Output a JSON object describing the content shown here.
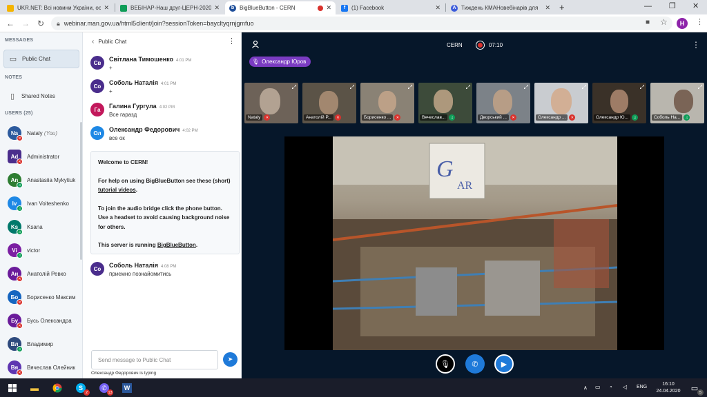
{
  "browser": {
    "tabs": [
      {
        "title": "UKR.NET: Всі новини України, ос",
        "active": false,
        "favicon_color": "#f4b400"
      },
      {
        "title": "ВЕБІНАР-Наш друг-ЦЕРН-2020-",
        "active": false,
        "favicon_color": "#0f9d58"
      },
      {
        "title": "BigBlueButton - CERN",
        "active": true,
        "favicon_color": "#1f4f9a"
      },
      {
        "title": "(1) Facebook",
        "active": false,
        "favicon_color": "#1877f2"
      },
      {
        "title": "Тиждень КМАНовебінарів для",
        "active": false,
        "favicon_color": "#3b5bdb"
      }
    ],
    "url": "webinar.man.gov.ua/html5client/join?sessionToken=bayclty​qrnjgmfuo",
    "profile_initial": "H"
  },
  "sidebar": {
    "messages_title": "MESSAGES",
    "public_chat_label": "Public Chat",
    "notes_title": "NOTES",
    "shared_notes_label": "Shared Notes",
    "users_title": "USERS (25)",
    "users": [
      {
        "initials": "Na",
        "name": "Nataly",
        "suffix": "(You)",
        "color": "#2d5b9e",
        "status": "mute"
      },
      {
        "initials": "Ad",
        "name": "Administrator",
        "suffix": "",
        "color": "#4a2d8c",
        "status": "mute"
      },
      {
        "initials": "An",
        "name": "Anastasiia Mykytiuk",
        "suffix": "",
        "color": "#2e7d32",
        "status": "live"
      },
      {
        "initials": "Iv",
        "name": "Ivan Voiteshenko",
        "suffix": "",
        "color": "#1e88e5",
        "status": "live"
      },
      {
        "initials": "Ks",
        "name": "Ksana",
        "suffix": "",
        "color": "#00796b",
        "status": "live"
      },
      {
        "initials": "Vi",
        "name": "victor",
        "suffix": "",
        "color": "#7b1fa2",
        "status": "live"
      },
      {
        "initials": "Ан",
        "name": "Анатолій Ревко",
        "suffix": "",
        "color": "#6a1b9a",
        "status": "mute"
      },
      {
        "initials": "Бо",
        "name": "Борисенко Максим",
        "suffix": "",
        "color": "#1565c0",
        "status": "mute"
      },
      {
        "initials": "Бу",
        "name": "Бусь Олександра",
        "suffix": "",
        "color": "#6a1b9a",
        "status": "mute"
      },
      {
        "initials": "Вл",
        "name": "Владимир",
        "suffix": "",
        "color": "#2e4a7d",
        "status": "live"
      },
      {
        "initials": "Вя",
        "name": "Вячеслав Олейник",
        "suffix": "",
        "color": "#5e35b1",
        "status": "mute"
      }
    ]
  },
  "chat": {
    "title": "Public Chat",
    "messages": [
      {
        "initials": "Св",
        "name": "Світлана Тимошенко",
        "time": "4:01 PM",
        "text": "+",
        "color": "#4a2d8c"
      },
      {
        "initials": "Со",
        "name": "Соболь Наталія",
        "time": "4:01 PM",
        "text": "+",
        "color": "#4a2d8c"
      },
      {
        "initials": "Га",
        "name": "Галина Гургула",
        "time": "4:02 PM",
        "text": "Все гаразд",
        "color": "#c2185b"
      },
      {
        "initials": "Ол",
        "name": "Олександр Федорович",
        "time": "4:02 PM",
        "text": "все ок",
        "color": "#1e88e5"
      }
    ],
    "welcome": {
      "heading": "Welcome to CERN!",
      "help_pre": "For help on using BigBlueButton see these (short) ",
      "help_link": "tutorial videos",
      "help_post": ".",
      "audio": "To join the audio bridge click the phone button. Use a headset to avoid causing background noise for others.",
      "server_pre": "This server is running ",
      "server_link": "BigBlueButton",
      "server_post": "."
    },
    "last_message": {
      "initials": "Со",
      "name": "Соболь Наталія",
      "time": "4:08 PM",
      "text": "приємно познайомитись",
      "color": "#4a2d8c"
    },
    "input_placeholder": "Send message to Public Chat",
    "typing": "Олександр Федорович is typing"
  },
  "main": {
    "room_title": "CERN",
    "record_time": "07:10",
    "talking_user": "Олександр Юров",
    "tiles": [
      {
        "name": "Nataly",
        "status": "mute",
        "bg": "#6d6258"
      },
      {
        "name": "Анатолій Р...",
        "status": "mute",
        "bg": "#5b5347"
      },
      {
        "name": "Борисенко ...",
        "status": "mute",
        "bg": "#8a8275"
      },
      {
        "name": "Вячеслав...",
        "status": "live",
        "bg": "#3d4b3a"
      },
      {
        "name": "Дворський ...",
        "status": "mute",
        "bg": "#7c8288"
      },
      {
        "name": "Олександр ...",
        "status": "mute",
        "bg": "#c9ccd0"
      },
      {
        "name": "Олександр Ю...",
        "status": "live",
        "bg": "#3a3128"
      },
      {
        "name": "Соболь На...",
        "status": "live",
        "bg": "#b9b6ae"
      }
    ]
  },
  "taskbar": {
    "lang": "ENG",
    "time": "16:10",
    "date": "24.04.2020",
    "badges": {
      "skype": "2",
      "viber": "13",
      "notifications": "5"
    }
  }
}
